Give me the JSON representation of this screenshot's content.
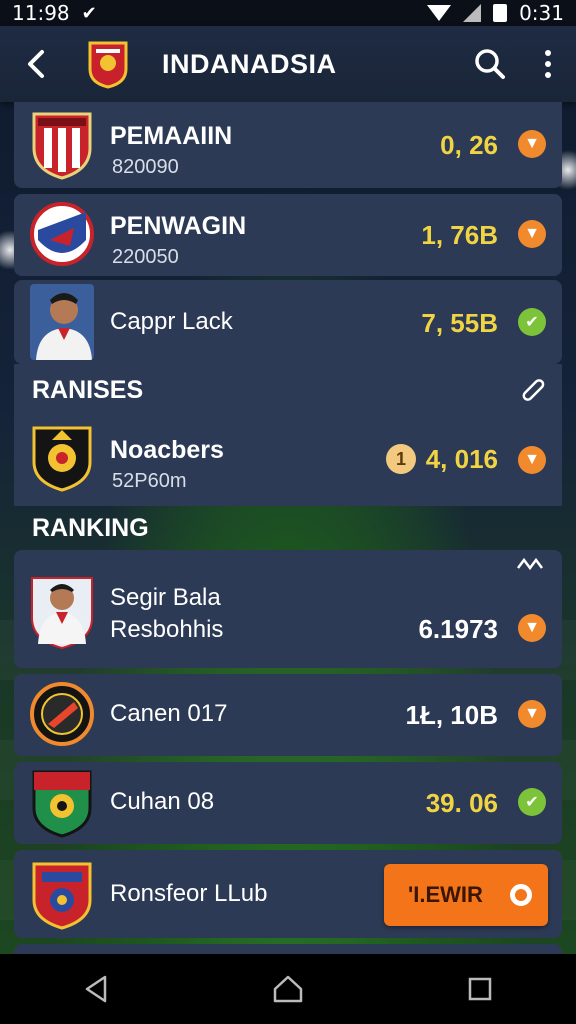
{
  "status_bar": {
    "time": "11:98",
    "clock_right": "0:31",
    "left_icon": "vodafone-icon"
  },
  "app_bar": {
    "title": "INDANADSIA"
  },
  "featured": [
    {
      "name": "PEMAAIIN",
      "sub": "820090",
      "value": "0, 26",
      "value_color": "#f1d443",
      "badge": "orange"
    },
    {
      "name": "PENWAGIN",
      "sub": "220050",
      "value": "1, 76B",
      "value_color": "#f1d443",
      "badge": "orange"
    },
    {
      "name": "Cappr Lack",
      "sub": "",
      "value": "7, 55B",
      "value_color": "#f1d443",
      "badge": "green"
    }
  ],
  "ranises": {
    "title": "RANISES",
    "item": {
      "name": "Noacbers",
      "sub": "52P60m",
      "coin": "1",
      "value": "4, 016",
      "badge": "orange"
    }
  },
  "ranking": {
    "title": "RANKING",
    "items": [
      {
        "name": "Segir Bala",
        "name2": "Resbohhis",
        "value": "6.1973",
        "badge": "orange"
      },
      {
        "name": "Canen 017",
        "value": "1Ł, 10B",
        "badge": "orange"
      },
      {
        "name": "Cuhan 08",
        "value": "39. 06",
        "badge": "green"
      },
      {
        "name": "Ronsfeor LLub",
        "cta": "'I.EWIR"
      }
    ]
  },
  "colors": {
    "accent": "#f47419",
    "card": "#2c3a55",
    "value_yellow": "#f1d443",
    "badge_orange": "#f08a2c",
    "badge_green": "#7cc33a"
  }
}
